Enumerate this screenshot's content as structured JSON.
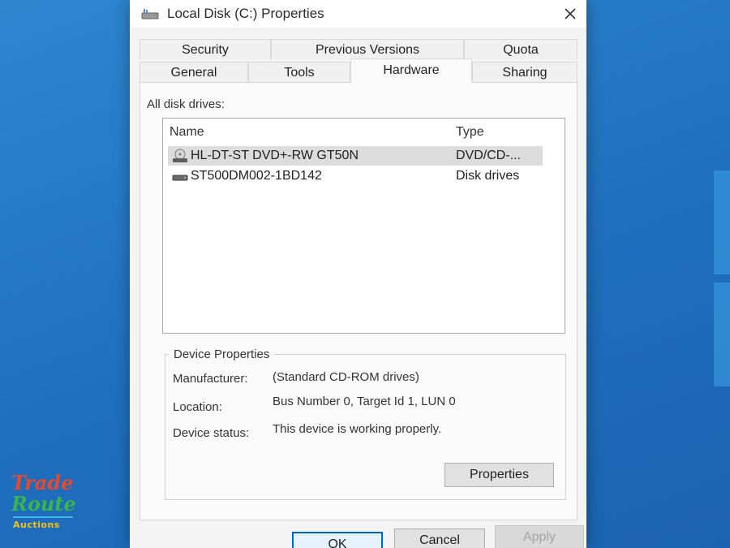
{
  "window": {
    "title": "Local Disk (C:) Properties",
    "title_icon": "drive-icon",
    "close_icon": "close-icon"
  },
  "tabs": {
    "back_row": [
      "Security",
      "Previous Versions",
      "Quota"
    ],
    "front_row": [
      "General",
      "Tools",
      "Hardware",
      "Sharing"
    ],
    "active": "Hardware"
  },
  "disk_drives": {
    "label": "All disk drives:",
    "columns": {
      "name": "Name",
      "type": "Type"
    },
    "rows": [
      {
        "name": "HL-DT-ST DVD+-RW GT50N",
        "type": "DVD/CD-...",
        "icon": "optical-drive-icon",
        "selected": true
      },
      {
        "name": "ST500DM002-1BD142",
        "type": "Disk drives",
        "icon": "hard-drive-icon",
        "selected": false
      }
    ]
  },
  "device_properties": {
    "title": "Device Properties",
    "manufacturer_label": "Manufacturer:",
    "manufacturer_value": "(Standard CD-ROM drives)",
    "location_label": "Location:",
    "location_value": "Bus Number 0, Target Id 1, LUN 0",
    "status_label": "Device status:",
    "status_value": "This device is working properly.",
    "properties_button": "Properties"
  },
  "buttons": {
    "ok": "OK",
    "cancel": "Cancel",
    "apply": "Apply"
  },
  "watermark": {
    "line1": "Trade",
    "line2": "Route",
    "line3": "Auctions"
  },
  "colors": {
    "desktop": "#1f6fbe",
    "dialog": "#f3f3f3",
    "accent": "#0067c0"
  }
}
